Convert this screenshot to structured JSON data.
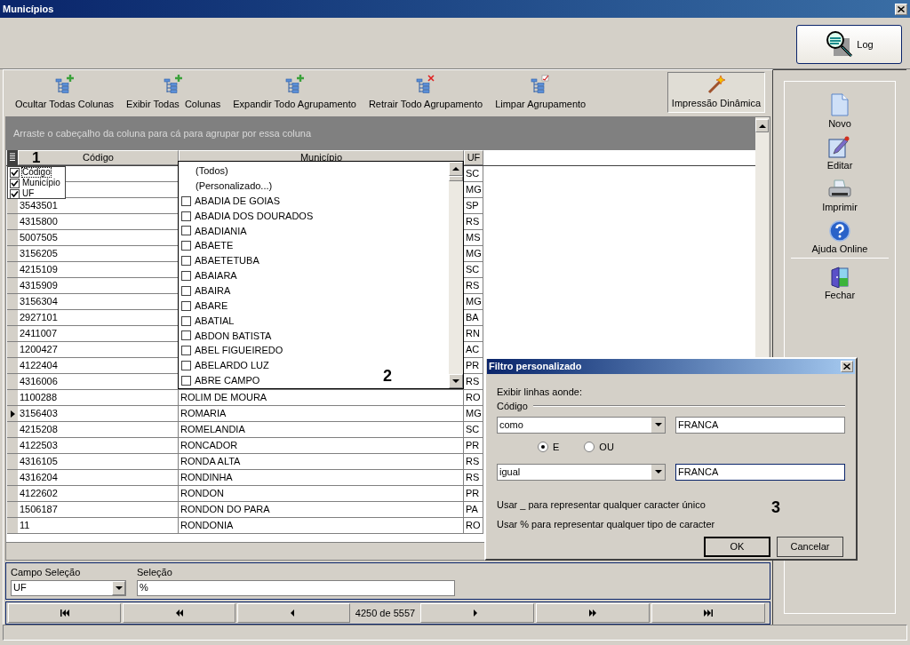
{
  "window": {
    "title": "Municípios"
  },
  "log_button": {
    "label": "Log"
  },
  "toolbar": [
    {
      "label": "Ocultar Todas Colunas",
      "kind": "add"
    },
    {
      "label": "Exibir Todas  Colunas",
      "kind": "add"
    },
    {
      "label": "Expandir Todo Agrupamento",
      "kind": "add"
    },
    {
      "label": "Retrair Todo Agrupamento",
      "kind": "remove"
    },
    {
      "label": "Limpar Agrupamento",
      "kind": "clear"
    }
  ],
  "print_button": {
    "label": "Impressão Dinâmica"
  },
  "grid": {
    "group_hint": "Arraste o cabeçalho da coluna para cá para agrupar por essa coluna",
    "columns": [
      {
        "label": "Código"
      },
      {
        "label": "Município"
      },
      {
        "label": "UF"
      }
    ],
    "rows": [
      {
        "uf": "SC"
      },
      {
        "uf": "MG"
      },
      {
        "code": "3543501",
        "uf": "SP",
        "current": false
      },
      {
        "code": "4315800",
        "uf": "RS",
        "current": false
      },
      {
        "code": "5007505",
        "uf": "MS",
        "current": false
      },
      {
        "code": "3156205",
        "uf": "MG",
        "current": false
      },
      {
        "code": "4215109",
        "uf": "SC",
        "current": false
      },
      {
        "code": "4315909",
        "uf": "RS",
        "current": false
      },
      {
        "code": "3156304",
        "uf": "MG",
        "current": false
      },
      {
        "code": "2927101",
        "uf": "BA",
        "current": false
      },
      {
        "code": "2411007",
        "uf": "RN",
        "current": false
      },
      {
        "code": "1200427",
        "uf": "AC",
        "current": false
      },
      {
        "code": "4122404",
        "uf": "PR",
        "current": false
      },
      {
        "code": "4316006",
        "uf": "RS",
        "current": false
      },
      {
        "code": "1100288",
        "name": "ROLIM DE MOURA",
        "uf": "RO",
        "current": false
      },
      {
        "code": "3156403",
        "name": "ROMARIA",
        "uf": "MG",
        "current": true
      },
      {
        "code": "4215208",
        "name": "ROMELANDIA",
        "uf": "SC",
        "current": false
      },
      {
        "code": "4122503",
        "name": "RONCADOR",
        "uf": "PR",
        "current": false
      },
      {
        "code": "4316105",
        "name": "RONDA ALTA",
        "uf": "RS",
        "current": false
      },
      {
        "code": "4316204",
        "name": "RONDINHA",
        "uf": "RS",
        "current": false
      },
      {
        "code": "4122602",
        "name": "RONDON",
        "uf": "PR",
        "current": false
      },
      {
        "code": "1506187",
        "name": "RONDON DO PARA",
        "uf": "PA",
        "current": false
      },
      {
        "code": "11",
        "name": "RONDONIA",
        "uf": "RO",
        "current": false
      }
    ]
  },
  "column_chooser": [
    {
      "label": "Código",
      "checked": true,
      "focused": true
    },
    {
      "label": "Município",
      "checked": true,
      "focused": false
    },
    {
      "label": "UF",
      "checked": true,
      "focused": false
    }
  ],
  "filter_dropdown": {
    "options": [
      "(Todos)",
      "(Personalizado...)"
    ],
    "items": [
      {
        "label": "ABADIA DE GOIAS",
        "checked": false
      },
      {
        "label": "ABADIA DOS DOURADOS",
        "checked": false
      },
      {
        "label": "ABADIANIA",
        "checked": false
      },
      {
        "label": "ABAETE",
        "checked": false
      },
      {
        "label": "ABAETETUBA",
        "checked": false
      },
      {
        "label": "ABAIARA",
        "checked": false
      },
      {
        "label": "ABAIRA",
        "checked": false
      },
      {
        "label": "ABARE",
        "checked": false
      },
      {
        "label": "ABATIAL",
        "checked": false
      },
      {
        "label": "ABDON BATISTA",
        "checked": false
      },
      {
        "label": "ABEL FIGUEIREDO",
        "checked": false
      },
      {
        "label": "ABELARDO LUZ",
        "checked": false
      },
      {
        "label": "ABRE CAMPO",
        "checked": false
      }
    ]
  },
  "selection": {
    "field_label": "Campo Seleção",
    "field_value": "UF",
    "value_label": "Seleção",
    "value": "%"
  },
  "navigator": {
    "position": "4250 de 5557"
  },
  "side_menu": [
    {
      "label": "Novo",
      "kind": "new"
    },
    {
      "label": "Editar",
      "kind": "edit"
    },
    {
      "label": "Imprimir",
      "kind": "print"
    },
    {
      "label": "Ajuda Online",
      "kind": "help"
    },
    {
      "label": "Fechar",
      "kind": "close"
    }
  ],
  "dialog": {
    "title": "Filtro personalizado",
    "prompt": "Exibir linhas aonde:",
    "group": "Código",
    "conditions": [
      {
        "operator": "como",
        "value": "FRANCA",
        "focused": false
      },
      {
        "operator": "igual",
        "value": "FRANCA",
        "focused": true
      }
    ],
    "joins": [
      {
        "label": "E",
        "selected": true
      },
      {
        "label": "OU",
        "selected": false
      }
    ],
    "hints": [
      "Usar _ para representar qualquer caracter único",
      "Usar % para representar qualquer tipo de caracter"
    ],
    "ok": "OK",
    "cancel": "Cancelar"
  },
  "annotations": [
    "1",
    "2",
    "3"
  ]
}
